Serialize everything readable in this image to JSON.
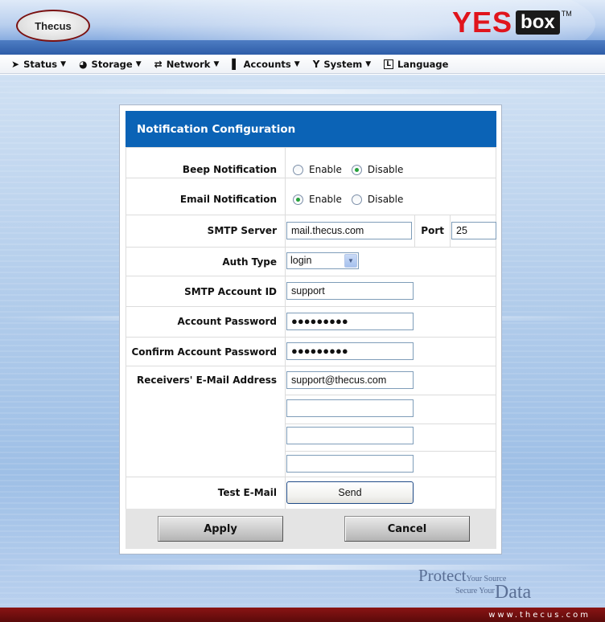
{
  "header": {
    "brand_left": "Thecus",
    "brand_right_1": "YES",
    "brand_right_2": "box",
    "brand_tm": "TM"
  },
  "menu": [
    {
      "label": "Status",
      "icon": "status-icon",
      "glyph": "➤",
      "arrow": "▼"
    },
    {
      "label": "Storage",
      "icon": "storage-icon",
      "glyph": "◕",
      "arrow": "▼"
    },
    {
      "label": "Network",
      "icon": "network-icon",
      "glyph": "⇄",
      "arrow": "▼"
    },
    {
      "label": "Accounts",
      "icon": "accounts-icon",
      "glyph": "▌",
      "arrow": "▼"
    },
    {
      "label": "System",
      "icon": "system-icon",
      "glyph": "Y",
      "arrow": "▼"
    },
    {
      "label": "Language",
      "icon": "language-icon",
      "glyph": "L",
      "arrow": ""
    }
  ],
  "panel": {
    "title": "Notification Configuration",
    "beep": {
      "label": "Beep Notification",
      "enable": "Enable",
      "disable": "Disable",
      "selected": "disable"
    },
    "email": {
      "label": "Email Notification",
      "enable": "Enable",
      "disable": "Disable",
      "selected": "enable"
    },
    "smtp": {
      "label": "SMTP Server",
      "value": "mail.thecus.com",
      "port_label": "Port",
      "port_value": "25"
    },
    "auth": {
      "label": "Auth Type",
      "value": "login"
    },
    "account_id": {
      "label": "SMTP Account ID",
      "value": "support"
    },
    "password": {
      "label": "Account Password",
      "value": "●●●●●●●●●"
    },
    "confirm": {
      "label": "Confirm Account Password",
      "value": "●●●●●●●●●"
    },
    "receivers": {
      "label": "Receivers' E-Mail Address",
      "values": [
        "support@thecus.com",
        "",
        "",
        ""
      ]
    },
    "test": {
      "label": "Test E-Mail",
      "button": "Send"
    },
    "apply": "Apply",
    "cancel": "Cancel"
  },
  "tagline": {
    "protect": "Protect",
    "your_source": "Your Source",
    "secure_your": "Secure Your",
    "data": "Data"
  },
  "footer": {
    "url": "www.thecus.com"
  }
}
